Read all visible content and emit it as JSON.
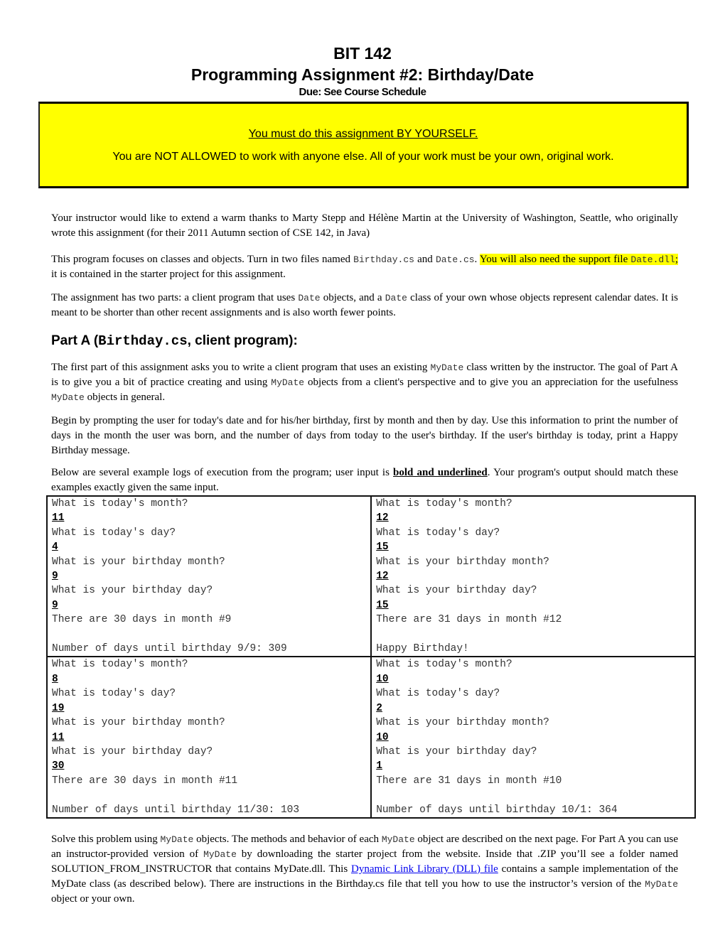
{
  "header": {
    "course": "BIT 142",
    "title": "Programming Assignment #2: Birthday/Date",
    "due": "Due: See Course Schedule"
  },
  "notice": {
    "line1": "You must do this assignment BY YOURSELF.",
    "line2": "You are NOT ALLOWED to work with anyone else.  All of your work must be your own, original work.",
    "background_color": "#ffff00"
  },
  "intro": {
    "thanks": "Your instructor would like to extend a warm thanks to Marty Stepp and Hélène Martin at the University of Washington, Seattle, who originally wrote this assignment (for their 2011 Autumn section of CSE 142, in Java)",
    "focus_pre": "This program focuses on classes and objects.  Turn in two files named ",
    "file1": "Birthday.cs",
    "and": " and ",
    "file2": "Date.cs",
    "period": ". ",
    "highlight_pre": "You will also need the support file ",
    "support_file": "Date.dll",
    "semicolon": ";",
    "focus_post": " it is contained in the starter project for this assignment.",
    "parts_1": "The assignment has two parts: a client program that uses ",
    "parts_code1": "Date",
    "parts_2": " objects, and a ",
    "parts_code2": "Date",
    "parts_3": " class of your own whose objects represent calendar dates.  It is meant to be shorter than other recent assignments and is also worth fewer points."
  },
  "part_a": {
    "heading_pre": "Part A (",
    "heading_code": "Birthday.cs",
    "heading_post": ", client program):",
    "p1_a": "The first part of this assignment asks you to write a client program that uses an existing ",
    "p1_code1": "MyDate",
    "p1_b": " class written by the instructor.  The goal of Part A is to give you a bit of practice creating and using ",
    "p1_code2": "MyDate",
    "p1_c": " objects from a client's perspective and to give you an appreciation for the usefulness ",
    "p1_code3": "MyDate",
    "p1_d": " objects in general.",
    "p2": "Begin by prompting the user for today's date and for his/her birthday, first by month and then by day.  Use this information to print the number of days in the month the user was born, and the number of days from today to the user's birthday.  If the user's birthday is today, print a Happy Birthday message.",
    "p3_a": "Below are several example logs of execution from the program; user input is ",
    "p3_bold": "bold and underlined",
    "p3_b": ".  Your program's output should match these examples exactly given the same input."
  },
  "logs": [
    {
      "q1": "What is today's month?",
      "a1": "11",
      "q2": "What is today's day?",
      "a2": "4",
      "q3": "What is your birthday month?",
      "a3": "9",
      "q4": "What is your birthday day?",
      "a4": "9",
      "days_line": "There are 30 days in month #9",
      "result": "Number of days until birthday 9/9: 309"
    },
    {
      "q1": "What is today's month?",
      "a1": "12",
      "q2": "What is today's day?",
      "a2": "15",
      "q3": "What is your birthday month?",
      "a3": "12",
      "q4": "What is your birthday day?",
      "a4": "15",
      "days_line": "There are 31 days in month #12",
      "result": "Happy Birthday!"
    },
    {
      "q1": "What is today's month?",
      "a1": "8",
      "q2": "What is today's day?",
      "a2": "19",
      "q3": "What is your birthday month?",
      "a3": "11",
      "q4": "What is your birthday day?",
      "a4": "30",
      "days_line": "There are 30 days in month #11",
      "result": "Number of days until birthday 11/30: 103"
    },
    {
      "q1": "What is today's month?",
      "a1": "10",
      "q2": "What is today's day?",
      "a2": "2",
      "q3": "What is your birthday month?",
      "a3": "10",
      "q4": "What is your birthday day?",
      "a4": "1",
      "days_line": "There are 31 days in month #10",
      "result": "Number of days until birthday 10/1: 364"
    }
  ],
  "solve": {
    "a": "Solve this problem using ",
    "code1": "MyDate",
    "b": " objects.  The methods and behavior of each ",
    "code2": "MyDate",
    "c": " object are described on the next page. For Part A you can use an instructor-provided version of ",
    "code3": "MyDate",
    "d": " by downloading the starter project from the website.  Inside that .ZIP you’ll see a folder named SOLUTION_FROM_INSTRUCTOR that contains MyDate.dll. This ",
    "link": "Dynamic Link Library (DLL) file",
    "e": " contains a sample implementation of the MyDate class (as described below).  There are instructions in the Birthday.cs file that tell you how to use the instructor’s version of the ",
    "code4": "MyDate",
    "f": " object or your own."
  }
}
